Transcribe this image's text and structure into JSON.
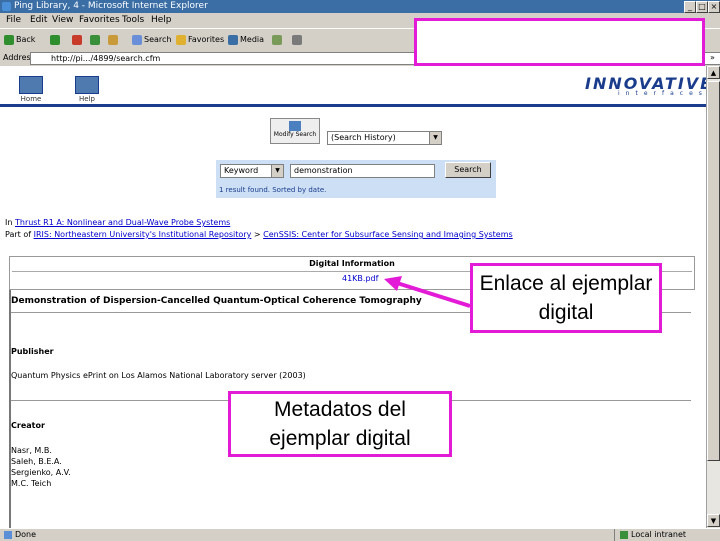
{
  "window": {
    "title": "Ping Library, 4 - Microsoft Internet Explorer",
    "buttons": [
      "_",
      "□",
      "×"
    ]
  },
  "menu": [
    "File",
    "Edit",
    "View",
    "Favorites",
    "Tools",
    "Help"
  ],
  "toolbar": {
    "back": "Back",
    "search": "Search",
    "favorites": "Favorites",
    "media": "Media"
  },
  "address": {
    "label": "Address",
    "url": "http://pi.../4899/search.cfm",
    "go_suffix": "»"
  },
  "page_header": {
    "home": "Home",
    "help": "Help",
    "logo_main": "INNOVATIVE",
    "logo_sub": "interfaces"
  },
  "search": {
    "modify_button": "Modify Search",
    "history_select": "(Search History)",
    "type_select": "Keyword",
    "query": "demonstration",
    "search_button": "Search",
    "result_line": "1 result found. Sorted by date."
  },
  "breadcrumbs": {
    "line1_prefix": "In",
    "line1_link": "Thrust R1 A: Nonlinear and Dual-Wave Probe Systems",
    "line2_prefix": "Part of",
    "line2_link1": "IRIS: Northeastern University's Institutional Repository",
    "line2_sep": ">",
    "line2_link2": "CenSSIS: Center for Subsurface Sensing and Imaging Systems"
  },
  "record": {
    "digital_info_title": "Digital Information",
    "digital_link": "41KB.pdf",
    "title": "Demonstration of Dispersion-Cancelled Quantum-Optical Coherence Tomography",
    "publisher_label": "Publisher",
    "publisher_value": "Quantum Physics ePrint on Los Alamos National Laboratory server (2003)",
    "creator_label": "Creator",
    "creators": [
      "Nasr, M.B.",
      "Saleh, B.E.A.",
      "Sergienko, A.V.",
      "M.C. Teich"
    ]
  },
  "status": {
    "left": "Done",
    "zone": "Local intranet"
  },
  "callouts": {
    "link_note": "Enlace al ejemplar digital",
    "metadata_note": "Metadatos del ejemplar digital"
  },
  "colors": {
    "callout_border": "#e31bd6",
    "titlebar": "#3a6ea5",
    "link": "#0000cc"
  }
}
